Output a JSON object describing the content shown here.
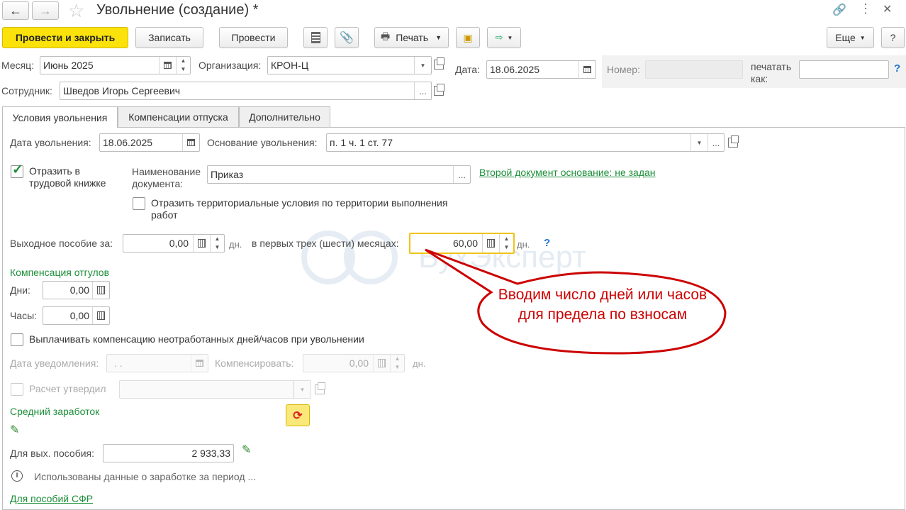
{
  "window": {
    "title": "Увольнение (создание) *"
  },
  "toolbar": {
    "post_close": "Провести и закрыть",
    "save": "Записать",
    "post": "Провести",
    "print": "Печать",
    "more": "Еще",
    "help": "?"
  },
  "header": {
    "month_label": "Месяц:",
    "month_value": "Июнь 2025",
    "org_label": "Организация:",
    "org_value": "КРОН-Ц",
    "date_label": "Дата:",
    "date_value": "18.06.2025",
    "number_label": "Номер:",
    "number_value": "",
    "print_as_label": "печатать как:",
    "print_as_value": "",
    "help": "?",
    "employee_label": "Сотрудник:",
    "employee_value": "Шведов Игорь Сергеевич"
  },
  "tabs": [
    "Условия увольнения",
    "Компенсации отпуска",
    "Дополнительно"
  ],
  "terms": {
    "dismissal_date_label": "Дата увольнения:",
    "dismissal_date_value": "18.06.2025",
    "basis_label": "Основание увольнения:",
    "basis_value": "п. 1 ч. 1 ст. 77",
    "workbook_label": "Отразить в трудовой книжке",
    "doc_name_label": "Наименование документа:",
    "doc_name_value": "Приказ",
    "second_doc_link": "Второй документ основание: не задан",
    "territorial_label": "Отразить территориальные условия по территории выполнения работ",
    "severance_label": "Выходное пособие за:",
    "severance_value": "0,00",
    "days_unit": "дн.",
    "first_months_label": "в первых трех (шести) месяцах:",
    "first_months_value": "60,00",
    "help": "?"
  },
  "comp_absence": {
    "title": "Компенсация отгулов",
    "days_label": "Дни:",
    "days_value": "0,00",
    "hours_label": "Часы:",
    "hours_value": "0,00",
    "pay_label": "Выплачивать компенсацию неотработанных дней/часов при увольнении",
    "notice_date_label": "Дата уведомления:",
    "notice_date_value": " .  .",
    "compensate_label": "Компенсировать:",
    "compensate_value": "0,00",
    "compensate_unit": "дн.",
    "approved_label": "Расчет утвердил",
    "approved_value": ""
  },
  "avg_earnings": {
    "title": "Средний заработок",
    "severance_label": "Для вых. пособия:",
    "severance_value": "2 933,33",
    "info_text": "Использованы данные о заработке за период ...",
    "sfr_link": "Для пособий СФР"
  },
  "callout": {
    "text": "Вводим число дней или часов для предела по взносам",
    "color": "#cc0000"
  },
  "watermark": "БухЭксперт"
}
